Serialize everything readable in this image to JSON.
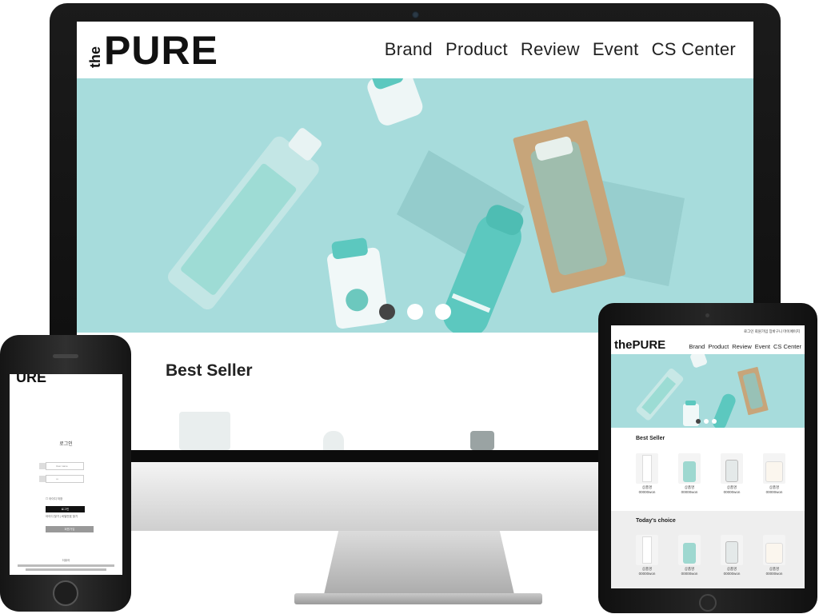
{
  "desktop": {
    "logo_small": "the",
    "logo_main": "PURE",
    "nav": [
      "Brand",
      "Product",
      "Review",
      "Event",
      "CS Center"
    ],
    "section_title": "Best Seller",
    "slider_active_index": 0,
    "slider_count": 3
  },
  "phone": {
    "logo": "URE",
    "login_title": "로그인",
    "id_placeholder": "User name",
    "pw_placeholder": "•••",
    "remember_label": "아이디 저장",
    "login_button": "로그인",
    "links": "아이디 찾기 | 비밀번호 찾기",
    "join_button": "회원가입",
    "footer": "더퓨어"
  },
  "tablet": {
    "top_links": "로그인  회원가입  장바구니  마이페이지",
    "logo": "thePURE",
    "nav": [
      "Brand",
      "Product",
      "Review",
      "Event",
      "CS Center"
    ],
    "best_title": "Best Seller",
    "today_title": "Today's choice",
    "product_name": "상품명",
    "product_price": "00000won",
    "colors": {
      "hero": "#a7dcdc",
      "accent": "#5cc8bf"
    }
  }
}
